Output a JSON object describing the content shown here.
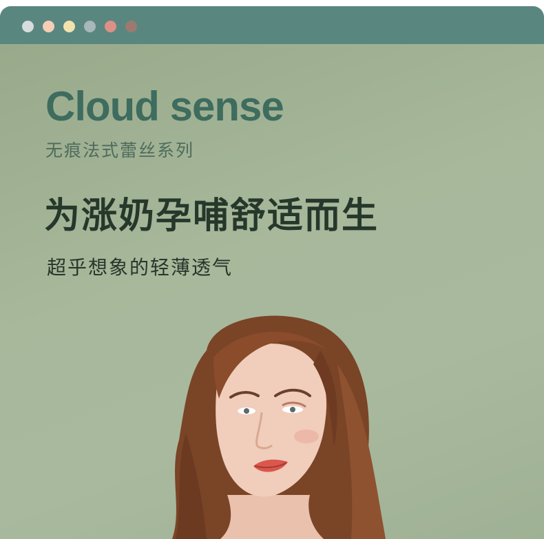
{
  "window": {
    "dots": [
      {
        "name": "dot-grey",
        "color": "#d7dcdc"
      },
      {
        "name": "dot-peach",
        "color": "#f4cfb6"
      },
      {
        "name": "dot-cream",
        "color": "#f3e2ae"
      },
      {
        "name": "dot-slate",
        "color": "#a7b7bb"
      },
      {
        "name": "dot-rose",
        "color": "#dd9085"
      },
      {
        "name": "dot-taupe",
        "color": "#9c7a70"
      }
    ]
  },
  "content": {
    "brand": "Cloud sense",
    "series": "无痕法式蕾丝系列",
    "slogan": "为涨奶孕哺舒适而生",
    "subtitle": "超乎想象的轻薄透气"
  },
  "colors": {
    "titlebar": "#5a8680",
    "background": "#a7b89b",
    "brand_text": "#3e6c5e",
    "slogan_text": "#26382b"
  }
}
